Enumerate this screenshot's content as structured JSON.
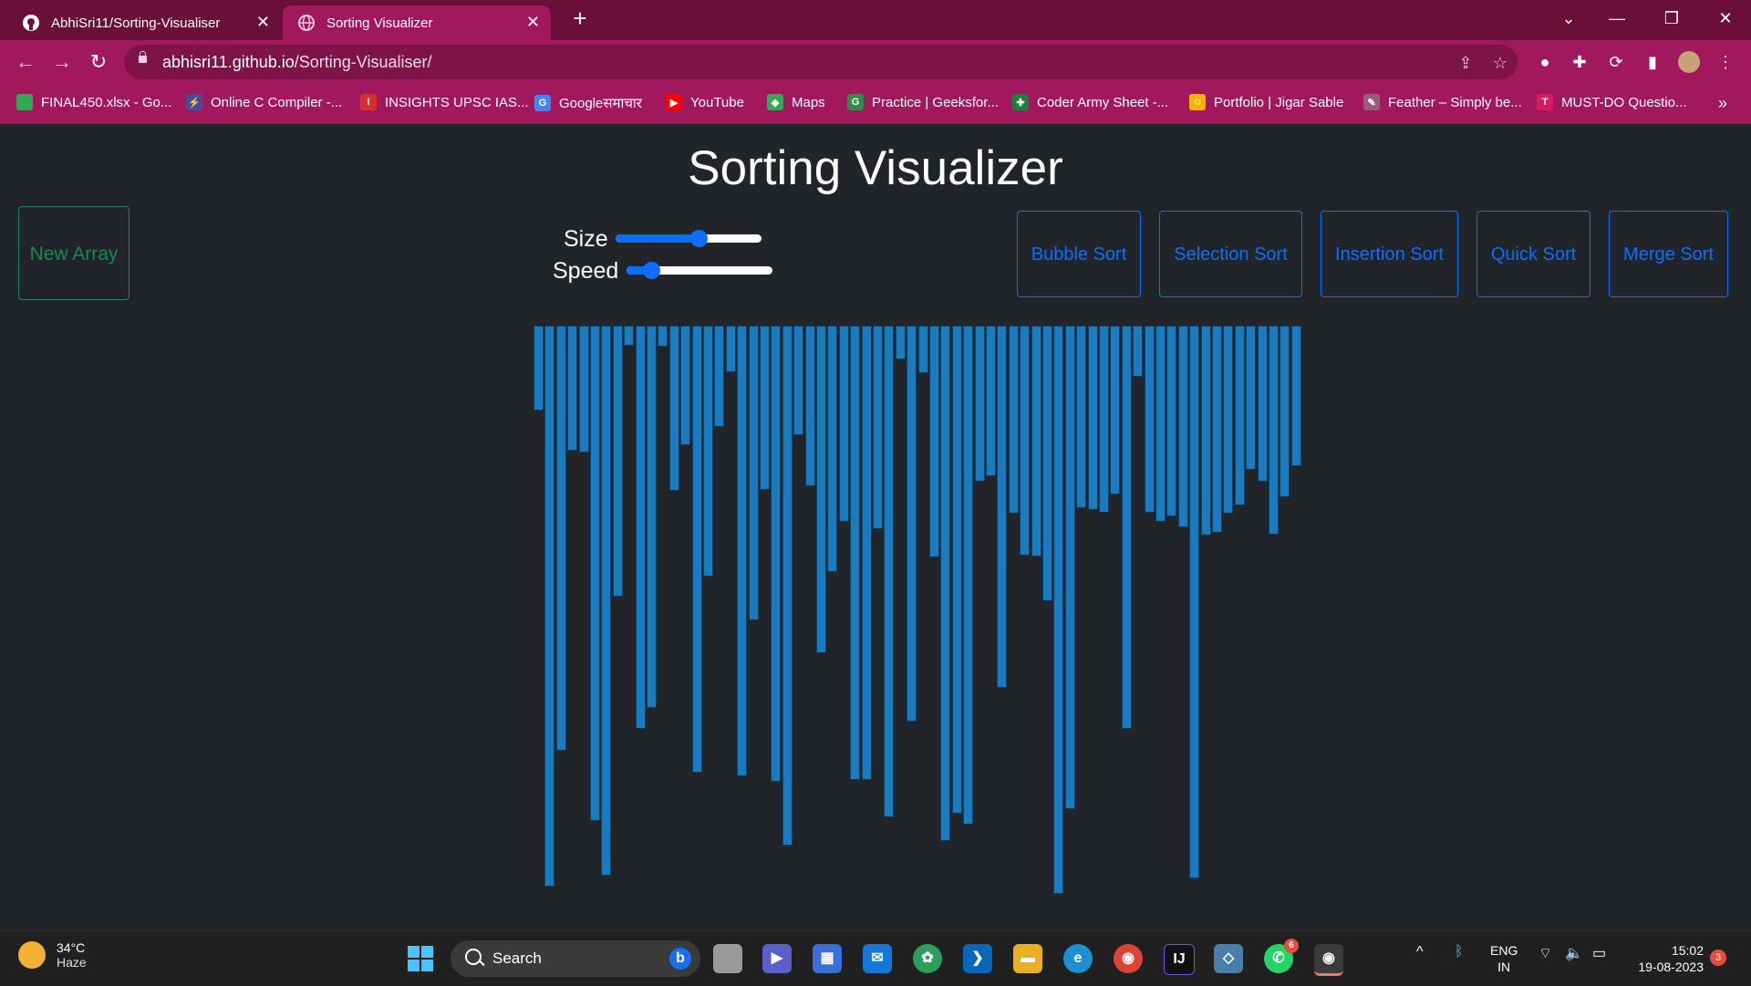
{
  "browser": {
    "tabs": [
      {
        "title": "AbhiSri11/Sorting-Visualiser",
        "icon": "github-icon"
      },
      {
        "title": "Sorting Visualizer",
        "icon": "globe-icon",
        "active": true
      }
    ],
    "url_host": "abhisri11.github.io",
    "url_path": "/Sorting-Visualiser/",
    "bookmarks": [
      {
        "label": "FINAL450.xlsx - Go...",
        "color": "#34a853"
      },
      {
        "label": "Online C Compiler -...",
        "color": "#4a4a9c"
      },
      {
        "label": "INSIGHTS UPSC IAS...",
        "color": "#d9302c"
      },
      {
        "label": "Googleसमाचार",
        "color": "#4285f4"
      },
      {
        "label": "YouTube",
        "color": "#ff0000"
      },
      {
        "label": "Maps",
        "color": "#34a853"
      },
      {
        "label": "Practice | Geeksfor...",
        "color": "#2f8d46"
      },
      {
        "label": "Coder Army Sheet -...",
        "color": "#188038"
      },
      {
        "label": "Portfolio | Jigar Sable",
        "color": "#f4b400"
      },
      {
        "label": "Feather – Simply be...",
        "color": "#9a5b7b"
      },
      {
        "label": "MUST-DO Questio...",
        "color": "#d81b60"
      }
    ],
    "overflow": "»"
  },
  "page": {
    "title": "Sorting Visualizer",
    "new_array": "New Array",
    "size_label": "Size",
    "speed_label": "Speed",
    "size_value": 0.57,
    "speed_value": 0.17,
    "sort_buttons": [
      "Bubble Sort",
      "Selection Sort",
      "Insertion Sort",
      "Quick Sort",
      "Merge Sort"
    ],
    "bar_color": "#1a7bbf",
    "bars": [
      93,
      615,
      466,
      137,
      139,
      543,
      603,
      297,
      0,
      22,
      442,
      419,
      23,
      181,
      131,
      490,
      275,
      111,
      51,
      494,
      323,
      180,
      500,
      570,
      120,
      176,
      359,
      270,
      215,
      498,
      498,
      223,
      539,
      37,
      434,
      52,
      254,
      565,
      535,
      547,
      171,
      165,
      397,
      206,
      252,
      253,
      302,
      623,
      530,
      200,
      202,
      205,
      185,
      442,
      56,
      205,
      215,
      209,
      221,
      606,
      230,
      227,
      206,
      197,
      158,
      171,
      229,
      188,
      154,
      0,
      0,
      0,
      0,
      0
    ]
  },
  "taskbar": {
    "temp": "34°C",
    "condition": "Haze",
    "search": "Search",
    "whatsapp_badge": "6",
    "lang_top": "ENG",
    "lang_bottom": "IN",
    "time": "15:02",
    "date": "19-08-2023",
    "notifications": "3"
  }
}
